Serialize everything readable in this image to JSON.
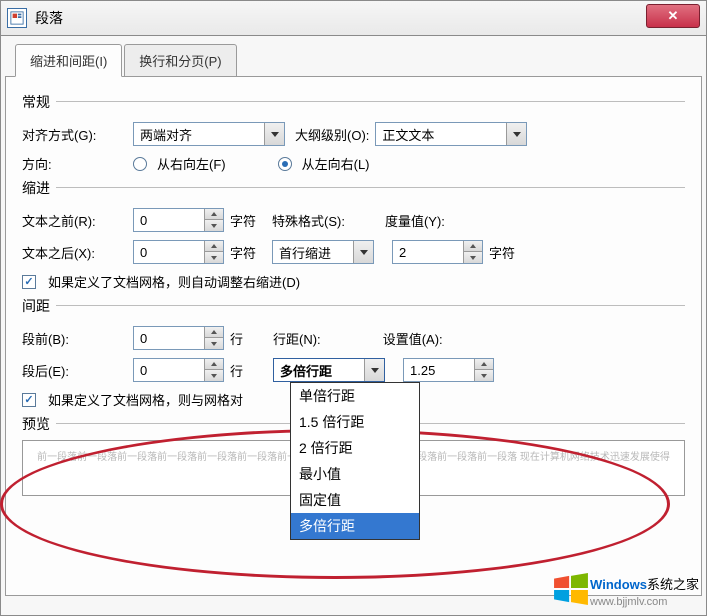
{
  "titlebar": {
    "title": "段落"
  },
  "tabs": {
    "active": "缩进和间距(I)",
    "inactive": "换行和分页(P)"
  },
  "sections": {
    "general": {
      "legend": "常规",
      "align_label": "对齐方式(G):",
      "align_value": "两端对齐",
      "outline_label": "大纲级别(O):",
      "outline_value": "正文文本",
      "direction_label": "方向:",
      "direction_rtl": "从右向左(F)",
      "direction_ltr": "从左向右(L)"
    },
    "indent": {
      "legend": "缩进",
      "before_label": "文本之前(R):",
      "before_value": "0",
      "unit_char": "字符",
      "special_label": "特殊格式(S):",
      "special_value": "首行缩进",
      "measure_label": "度量值(Y):",
      "measure_value": "2",
      "after_label": "文本之后(X):",
      "after_value": "0",
      "grid_check": "如果定义了文档网格，则自动调整右缩进(D)"
    },
    "spacing": {
      "legend": "间距",
      "before_label": "段前(B):",
      "before_value": "0",
      "unit_line": "行",
      "line_label": "行距(N):",
      "line_value": "多倍行距",
      "setvalue_label": "设置值(A):",
      "setvalue_value": "1.25",
      "after_label": "段后(E):",
      "after_value": "0",
      "grid_check": "如果定义了文档网格，则与网格对"
    },
    "preview": {
      "legend": "预览",
      "sample": "前一段落前一段落前一段落前一段落前一段落前一段落前一段落前一段落前一段落前一段落前一段落前一段落 现在计算机网络技术迅速发展使得路由器多倍行距"
    }
  },
  "dropdown_options": [
    {
      "text": "单倍行距",
      "selected": false
    },
    {
      "text": "1.5 倍行距",
      "selected": false
    },
    {
      "text": "2 倍行距",
      "selected": false
    },
    {
      "text": "最小值",
      "selected": false
    },
    {
      "text": "固定值",
      "selected": false
    },
    {
      "text": "多倍行距",
      "selected": true
    }
  ],
  "watermark": {
    "brand": "Windows",
    "sub": "系统之家",
    "url": "www.bjjmlv.com"
  }
}
